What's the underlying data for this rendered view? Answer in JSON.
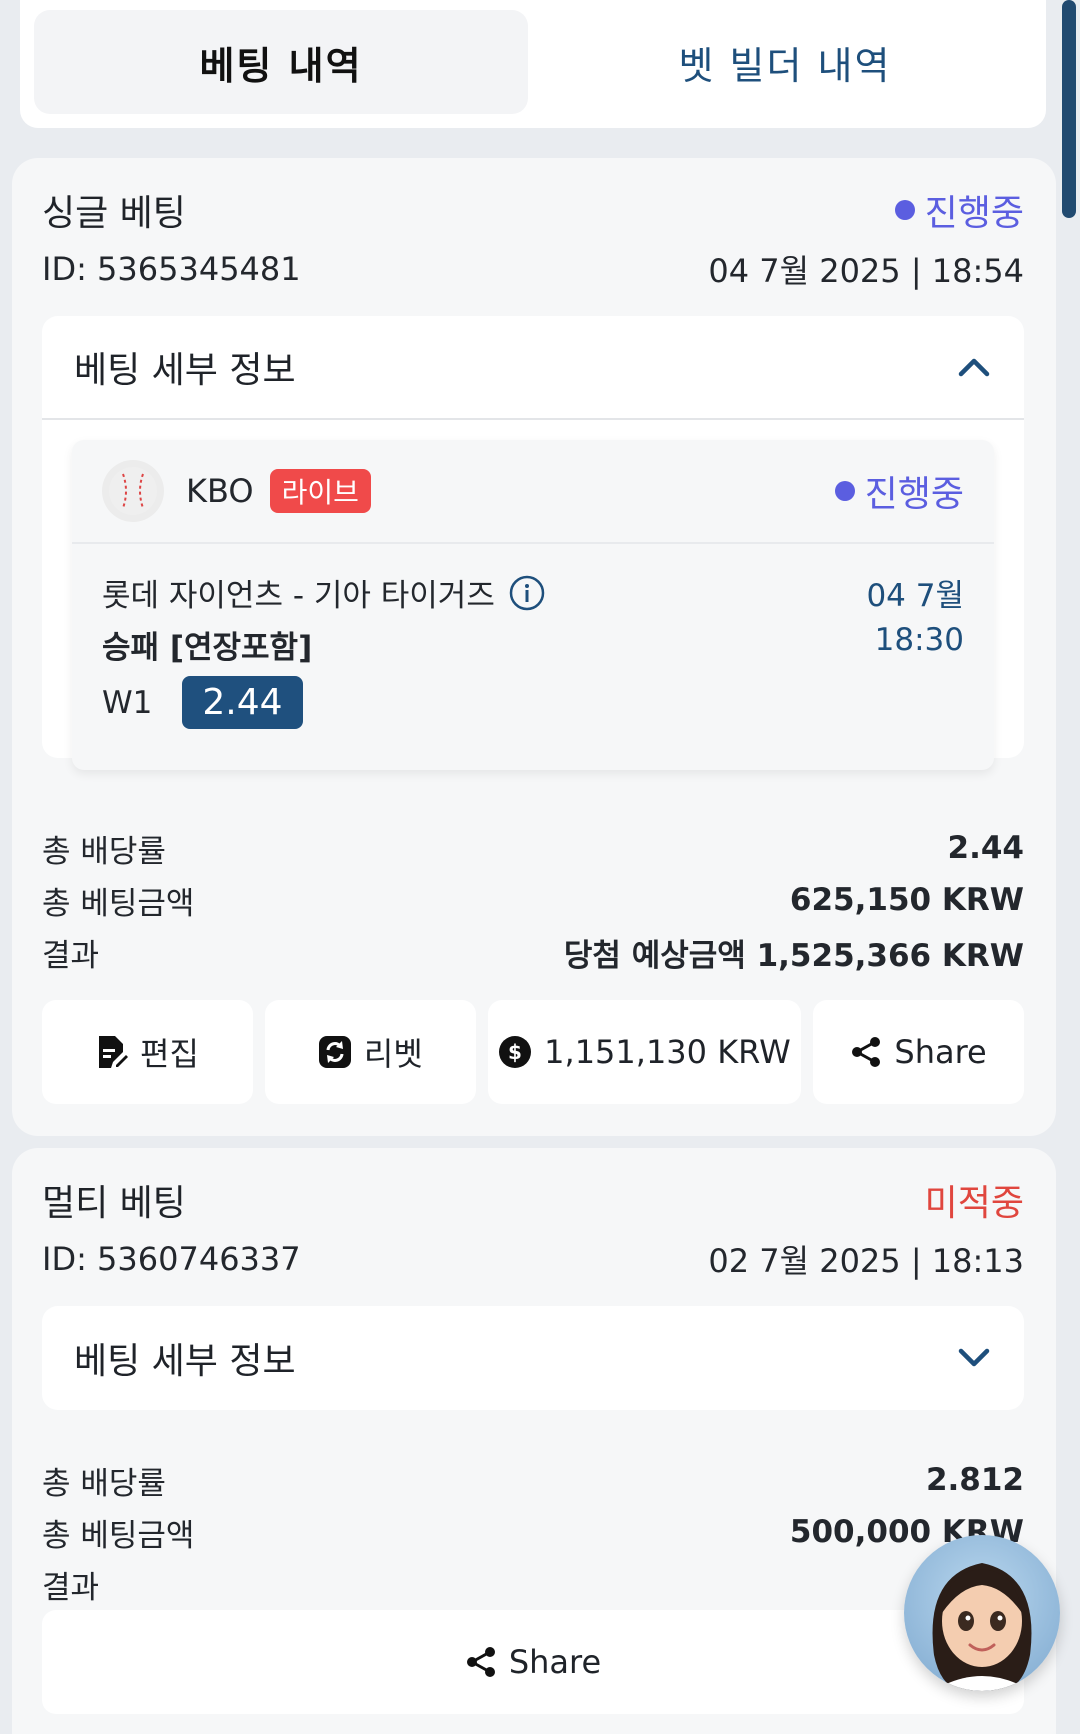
{
  "tabs": {
    "active": "베팅 내역",
    "inactive": "벳 빌더 내역"
  },
  "bets": [
    {
      "type": "싱글 베팅",
      "status": "진행중",
      "id": "ID: 5365345481",
      "datetime": "04 7월 2025 | 18:54",
      "details_title": "베팅 세부 정보",
      "event": {
        "league": "KBO",
        "live_badge": "라이브",
        "status": "진행중",
        "match": "롯데 자이언츠 - 기아 타이거즈",
        "market": "승패 [연장포함]",
        "date": "04 7월",
        "time": "18:30",
        "pick": "W1",
        "odds": "2.44"
      },
      "summary": {
        "odds_label": "총 배당률",
        "odds_value": "2.44",
        "stake_label": "총 베팅금액",
        "stake_value": "625,150 KRW",
        "result_label": "결과",
        "result_value": "당첨 예상금액 1,525,366 KRW"
      },
      "actions": {
        "edit": "편집",
        "rebet": "리벳",
        "cashout": "1,151,130 KRW",
        "share": "Share"
      }
    },
    {
      "type": "멀티 베팅",
      "status": "미적중",
      "id": "ID: 5360746337",
      "datetime": "02 7월 2025 | 18:13",
      "details_title": "베팅 세부 정보",
      "summary": {
        "odds_label": "총 배당률",
        "odds_value": "2.812",
        "stake_label": "총 베팅금액",
        "stake_value": "500,000 KRW",
        "result_label": "결과"
      },
      "actions": {
        "share": "Share"
      }
    }
  ],
  "colors": {
    "accent": "#1f507e",
    "ongoing": "#5b5ee0",
    "lost": "#e0463e",
    "live": "#f04a4a"
  }
}
